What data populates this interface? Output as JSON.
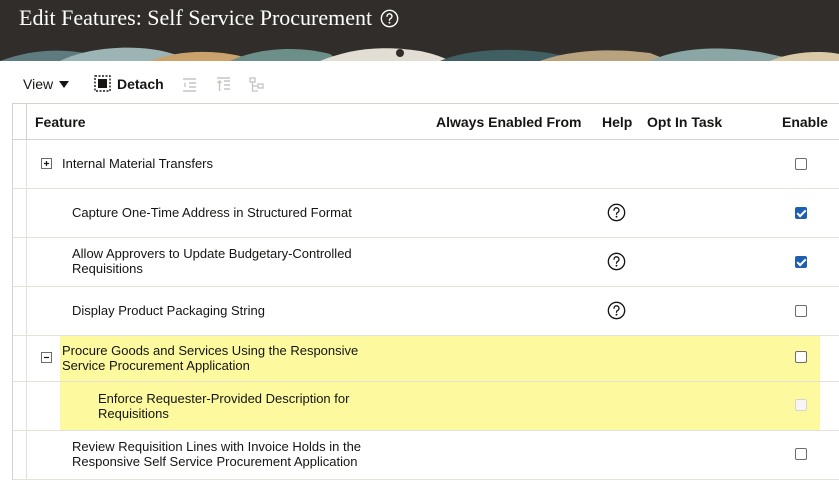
{
  "header": {
    "title": "Edit Features: Self Service Procurement"
  },
  "toolbar": {
    "view_label": "View",
    "detach_label": "Detach"
  },
  "table": {
    "columns": {
      "feature": "Feature",
      "always_enabled_from": "Always Enabled From",
      "help": "Help",
      "opt_in_task": "Opt In Task",
      "enable": "Enable"
    },
    "rows": [
      {
        "name": "Internal Material Transfers",
        "toggle": "expand",
        "help": false,
        "enabled": false,
        "disabled": false,
        "highlighted": false
      },
      {
        "name": "Capture One-Time Address in Structured Format",
        "help": true,
        "enabled": true,
        "disabled": false,
        "highlighted": false
      },
      {
        "name": "Allow Approvers to Update Budgetary-Controlled Requisitions",
        "help": true,
        "enabled": true,
        "disabled": false,
        "highlighted": false
      },
      {
        "name": "Display Product Packaging String",
        "help": true,
        "enabled": false,
        "disabled": false,
        "highlighted": false
      },
      {
        "name": "Procure Goods and Services Using the Responsive Service Procurement Application",
        "toggle": "collapse",
        "help": false,
        "enabled": false,
        "disabled": false,
        "highlighted": true
      },
      {
        "name": "Enforce Requester-Provided Description for Requisitions",
        "help": false,
        "enabled": false,
        "disabled": true,
        "highlighted": true
      },
      {
        "name": "Review Requisition Lines with Invoice Holds in the Responsive Self Service Procurement Application",
        "help": false,
        "enabled": false,
        "disabled": false,
        "highlighted": false
      }
    ]
  },
  "colors": {
    "header_bg": "#312d2a",
    "highlight": "#fcf99e",
    "check_blue": "#1e5fb4"
  }
}
